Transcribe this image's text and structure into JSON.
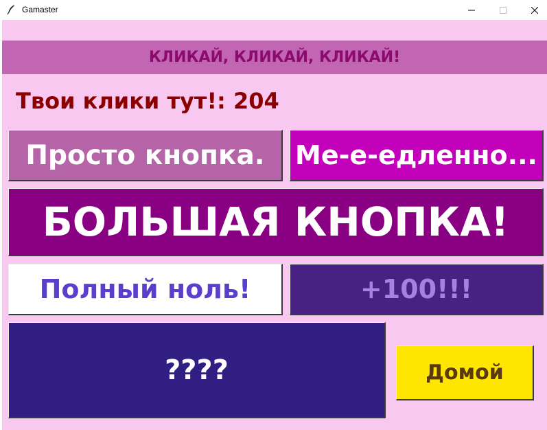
{
  "window": {
    "title": "Gamaster",
    "app_icon": "feather-icon",
    "controls": [
      "minimize-icon",
      "maximize-icon",
      "close-icon"
    ]
  },
  "banner": {
    "text": "КЛИКАЙ, КЛИКАЙ, КЛИКАЙ!"
  },
  "counter": {
    "label": "Твои клики тут!: 204"
  },
  "buttons": {
    "simple": "Просто кнопка.",
    "slow": "Ме-е-едленно...",
    "big": "БОЛЬШАЯ КНОПКА!",
    "zero": "Полный ноль!",
    "plus100": "+100!!!",
    "mystery": "????",
    "home": "Домой"
  },
  "colors": {
    "background": "#f9c8f1",
    "banner_bg": "#c266b3",
    "banner_text": "#8b0a6e",
    "counter_text": "#8b0000",
    "simple_bg": "#b565a7",
    "slow_bg": "#c300ba",
    "big_bg": "#8a0083",
    "zero_bg": "#ffffff",
    "zero_text": "#5a3fcc",
    "plus_bg": "#482182",
    "plus_text": "#a682e0",
    "mystery_bg": "#301e83",
    "home_bg": "#ffe600",
    "home_text": "#5a3a0a"
  }
}
